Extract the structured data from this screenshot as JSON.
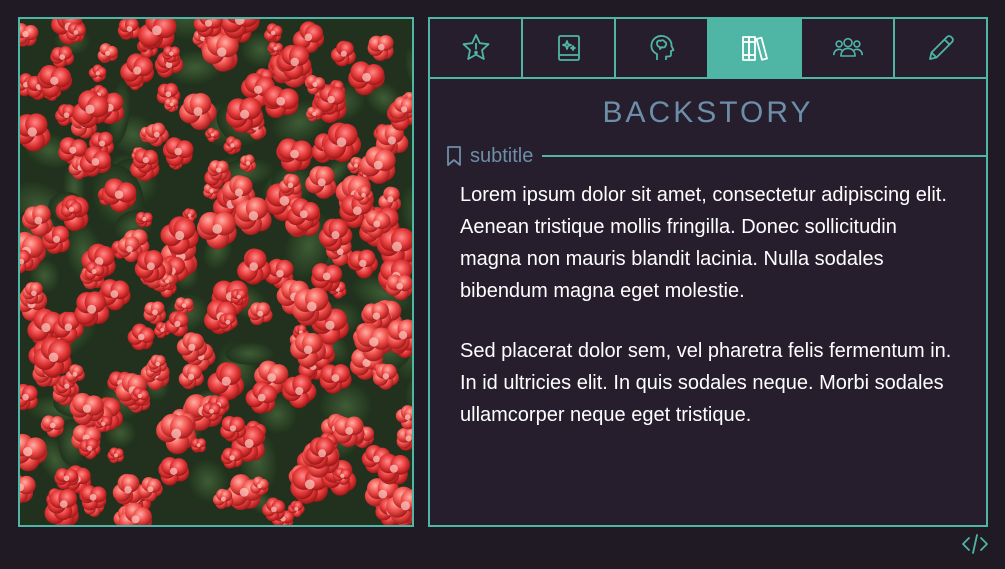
{
  "colors": {
    "accent": "#4fb5a5",
    "background": "#1f1a24",
    "card": "#261e2d",
    "title": "#6d8ea8",
    "text": "#ffffff"
  },
  "tabs": [
    {
      "icon": "star-icon",
      "active": false
    },
    {
      "icon": "sparkle-book-icon",
      "active": false
    },
    {
      "icon": "head-profile-icon",
      "active": false
    },
    {
      "icon": "library-books-icon",
      "active": true
    },
    {
      "icon": "users-group-icon",
      "active": false
    },
    {
      "icon": "pencil-icon",
      "active": false
    }
  ],
  "card": {
    "title": "BACKSTORY",
    "subtitle": "subtitle",
    "paragraphs": [
      "Lorem ipsum dolor sit amet, consectetur adipiscing elit. Aenean tristique mollis fringilla. Donec sollicitudin magna non mauris blandit lacinia. Nulla sodales bibendum magna eget molestie.",
      "Sed placerat dolor sem, vel pharetra felis fermentum in. In id ultricies elit. In quis sodales neque. Morbi sodales ullamcorper neque eget tristique."
    ]
  },
  "footer": {
    "icon": "code-icon"
  }
}
